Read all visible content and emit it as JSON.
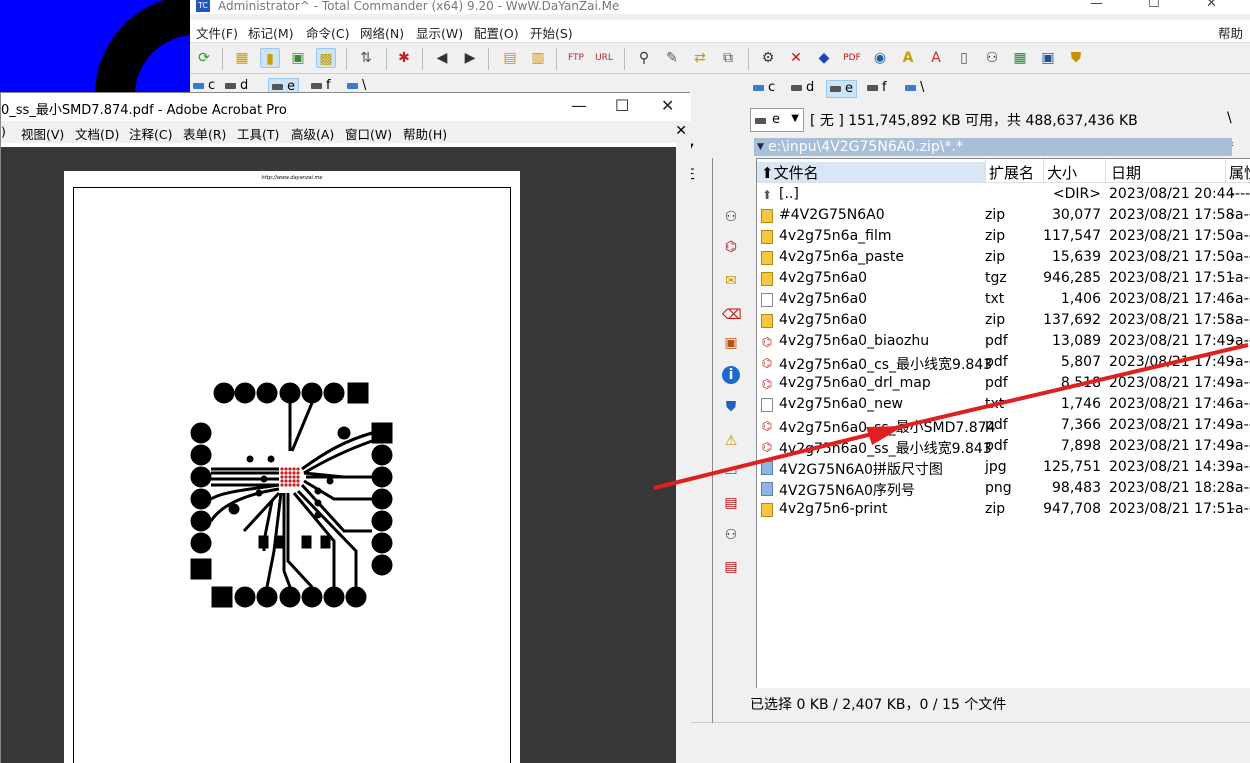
{
  "tc": {
    "title": "Administrator^ - Total Commander (x64) 9.20 - WwW.DaYanZai.Me",
    "help": "帮助",
    "menu": [
      "文件(F)",
      "标记(M)",
      "命令(C)",
      "网络(N)",
      "显示(W)",
      "配置(O)",
      "开始(S)"
    ],
    "drives_left": [
      "c",
      "d",
      "e",
      "f",
      "\\"
    ],
    "drives_right": [
      "c",
      "d",
      "e",
      "f",
      "\\"
    ],
    "combo_drive": "e",
    "free_space": "[ 无 ]  151,745,892 KB 可用，共 488,637,436 KB",
    "root_button": "\\",
    "star_button": "*",
    "path": "e:\\inpu\\4V2G75N6A0.zip\\*.*",
    "columns": [
      "文件名",
      "扩展名",
      "大小",
      "日期",
      "属性"
    ],
    "files": [
      {
        "name": "[..]",
        "ext": "",
        "size": "<DIR>",
        "date": "2023/08/21 20:44",
        "attr": "----",
        "type": "up"
      },
      {
        "name": "#4V2G75N6A0",
        "ext": "zip",
        "size": "30,077",
        "date": "2023/08/21 17:58",
        "attr": "-a--",
        "type": "zip"
      },
      {
        "name": "4v2g75n6a_film",
        "ext": "zip",
        "size": "117,547",
        "date": "2023/08/21 17:50",
        "attr": "-a--",
        "type": "zip"
      },
      {
        "name": "4v2g75n6a_paste",
        "ext": "zip",
        "size": "15,639",
        "date": "2023/08/21 17:50",
        "attr": "-a--",
        "type": "zip"
      },
      {
        "name": "4v2g75n6a0",
        "ext": "tgz",
        "size": "946,285",
        "date": "2023/08/21 17:51",
        "attr": "-a--",
        "type": "zip"
      },
      {
        "name": "4v2g75n6a0",
        "ext": "txt",
        "size": "1,406",
        "date": "2023/08/21 17:46",
        "attr": "-a--",
        "type": "txt"
      },
      {
        "name": "4v2g75n6a0",
        "ext": "zip",
        "size": "137,692",
        "date": "2023/08/21 17:58",
        "attr": "-a--",
        "type": "zip"
      },
      {
        "name": "4v2g75n6a0_biaozhu",
        "ext": "pdf",
        "size": "13,089",
        "date": "2023/08/21 17:49",
        "attr": "-a--",
        "type": "pdf"
      },
      {
        "name": "4v2g75n6a0_cs_最小线宽9.843",
        "ext": "pdf",
        "size": "5,807",
        "date": "2023/08/21 17:49",
        "attr": "-a--",
        "type": "pdf"
      },
      {
        "name": "4v2g75n6a0_drl_map",
        "ext": "pdf",
        "size": "8,518",
        "date": "2023/08/21 17:49",
        "attr": "-a--",
        "type": "pdf"
      },
      {
        "name": "4v2g75n6a0_new",
        "ext": "txt",
        "size": "1,746",
        "date": "2023/08/21 17:46",
        "attr": "-a--",
        "type": "txt"
      },
      {
        "name": "4v2g75n6a0_ss_最小SMD7.874",
        "ext": "pdf",
        "size": "7,366",
        "date": "2023/08/21 17:49",
        "attr": "-a--",
        "type": "pdf"
      },
      {
        "name": "4v2g75n6a0_ss_最小线宽9.843",
        "ext": "pdf",
        "size": "7,898",
        "date": "2023/08/21 17:49",
        "attr": "-a--",
        "type": "pdf"
      },
      {
        "name": "4V2G75N6A0拼版尺寸图",
        "ext": "jpg",
        "size": "125,751",
        "date": "2023/08/21 14:39",
        "attr": "-a--",
        "type": "img"
      },
      {
        "name": "4V2G75N6A0序列号",
        "ext": "png",
        "size": "98,483",
        "date": "2023/08/21 18:28",
        "attr": "-a--",
        "type": "img"
      },
      {
        "name": "4v2g75n6-print",
        "ext": "zip",
        "size": "947,708",
        "date": "2023/08/21 17:51",
        "attr": "-a--",
        "type": "zip"
      }
    ],
    "status": "已选择 0 KB / 2,407 KB，0 / 15 个文件",
    "left_panel_fragments": [
      "..",
      "性"
    ]
  },
  "acrobat": {
    "title": "0_ss_最小SMD7.874.pdf - Adobe Acrobat Pro",
    "menu": [
      ")",
      "视图(V)",
      "文档(D)",
      "注释(C)",
      "表单(R)",
      "工具(T)",
      "高级(A)",
      "窗口(W)",
      "帮助(H)"
    ],
    "page_header": "http://www.dayanzai.me"
  },
  "colors": {
    "desktop": "#0000ff",
    "path_bar": "#a7bfd8",
    "arrow": "#e02020",
    "sorted_header": "#d8e6f5"
  }
}
